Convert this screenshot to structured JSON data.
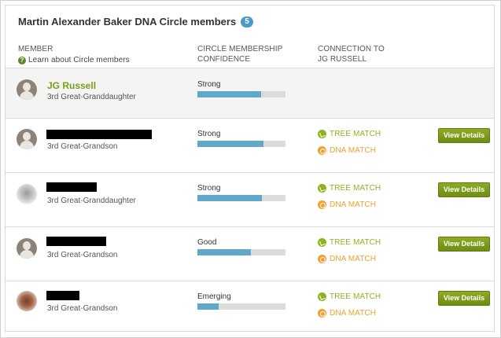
{
  "header": {
    "title": "Martin Alexander Baker DNA Circle members",
    "count": "5"
  },
  "columns": {
    "member": "MEMBER",
    "learn_link": "Learn about Circle members",
    "confidence_line1": "CIRCLE MEMBERSHIP",
    "confidence_line2": "CONFIDENCE",
    "connection_line1": "CONNECTION TO",
    "connection_line2": "JG RUSSELL"
  },
  "members": [
    {
      "name": "JG Russell",
      "relationship": "3rd Great-Granddaughter",
      "confidence": "Strong",
      "confidence_level": 0.72
    },
    {
      "name": "",
      "relationship": "3rd Great-Grandson",
      "confidence": "Strong",
      "confidence_level": 0.75,
      "tree_match": "TREE MATCH",
      "dna_match": "DNA MATCH",
      "button": "View Details"
    },
    {
      "name": "",
      "relationship": "3rd Great-Granddaughter",
      "confidence": "Strong",
      "confidence_level": 0.73,
      "tree_match": "TREE MATCH",
      "dna_match": "DNA MATCH",
      "button": "View Details"
    },
    {
      "name": "",
      "relationship": "3rd Great-Grandson",
      "confidence": "Good",
      "confidence_level": 0.61,
      "tree_match": "TREE MATCH",
      "dna_match": "DNA MATCH",
      "button": "View Details"
    },
    {
      "name": "",
      "relationship": "3rd Great-Grandson",
      "confidence": "Emerging",
      "confidence_level": 0.24,
      "tree_match": "TREE MATCH",
      "dna_match": "DNA MATCH",
      "button": "View Details"
    }
  ],
  "icons": {
    "help": "question-circle-icon",
    "tree": "tree-match-icon",
    "dna": "dna-match-icon"
  },
  "colors": {
    "accent_green": "#7a9d1c",
    "badge_blue": "#4c9bc6",
    "bar_fill": "#5fa8c9",
    "dna_orange": "#f0a030"
  }
}
